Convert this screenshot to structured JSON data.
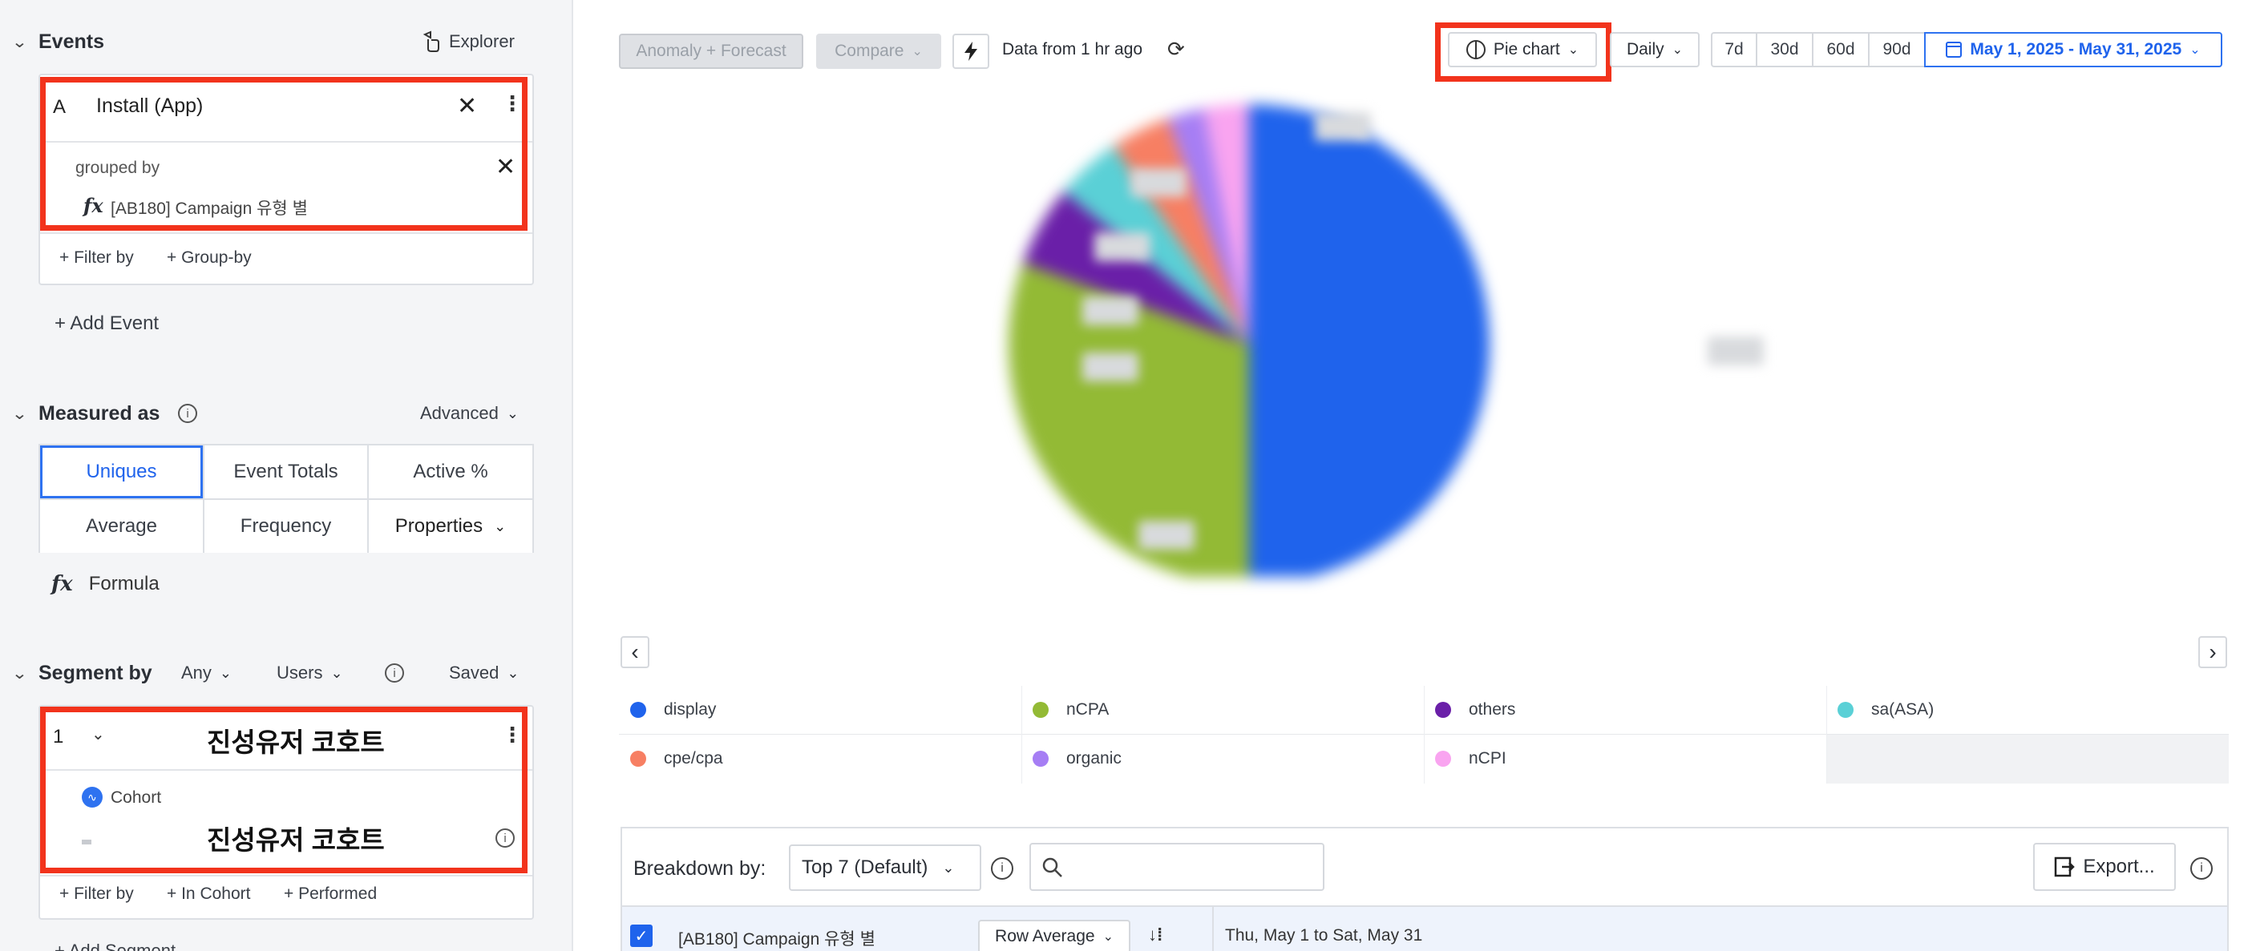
{
  "left": {
    "events": {
      "title": "Events",
      "explorer_label": "Explorer",
      "event_letter": "A",
      "event_name": "Install (App)",
      "grouped_by_label": "grouped by",
      "group_prop": "[AB180] Campaign 유형 별",
      "filter_by": "+ Filter by",
      "group_by": "+ Group-by",
      "add_event": "+ Add Event"
    },
    "measured": {
      "title": "Measured as",
      "advanced": "Advanced",
      "buttons": [
        "Uniques",
        "Event Totals",
        "Active %",
        "Average",
        "Frequency",
        "Properties"
      ],
      "formula": "Formula"
    },
    "segment": {
      "title": "Segment by",
      "any": "Any",
      "users": "Users",
      "saved": "Saved",
      "index": "1",
      "segment_name": "진성유저 코호트",
      "cohort_label": "Cohort",
      "cohort_value": "진성유저 코호트",
      "filter_by": "+ Filter by",
      "in_cohort": "+ In Cohort",
      "performed": "+ Performed",
      "add_segment": "+ Add Segment"
    }
  },
  "toolbar": {
    "anomaly": "Anomaly + Forecast",
    "compare": "Compare",
    "data_freshness": "Data from 1 hr ago",
    "chart_type": "Pie chart",
    "interval": "Daily",
    "ranges": [
      "7d",
      "30d",
      "60d",
      "90d"
    ],
    "date_range": "May 1, 2025 - May 31, 2025"
  },
  "chart_data": {
    "type": "pie",
    "labels": [
      "display",
      "nCPA",
      "others",
      "sa(ASA)",
      "cpe/cpa",
      "organic",
      "nCPI"
    ],
    "values": [
      50.0,
      30.5,
      5.5,
      4.5,
      4.0,
      2.5,
      3.0
    ],
    "colors": [
      "#1f63ec",
      "#93ba35",
      "#6a1fa8",
      "#5ad0d6",
      "#f77f63",
      "#a67ef4",
      "#f9a4f0"
    ],
    "legend": "bottom"
  },
  "legend": [
    {
      "label": "display",
      "color": "#1f63ec"
    },
    {
      "label": "nCPA",
      "color": "#93ba35"
    },
    {
      "label": "others",
      "color": "#6a1fa8"
    },
    {
      "label": "sa(ASA)",
      "color": "#5ad0d6"
    },
    {
      "label": "cpe/cpa",
      "color": "#f77f63"
    },
    {
      "label": "organic",
      "color": "#a67ef4"
    },
    {
      "label": "nCPI",
      "color": "#f9a4f0"
    }
  ],
  "table": {
    "breakdown_label": "Breakdown by:",
    "breakdown_value": "Top 7 (Default)",
    "search_placeholder": "",
    "export_label": "Export...",
    "col_property": "[AB180] Campaign 유형 별",
    "col_row_avg": "Row Average",
    "col_date": "Thu, May 1 to Sat, May 31"
  },
  "nav": {
    "prev": "‹",
    "next": "›"
  }
}
